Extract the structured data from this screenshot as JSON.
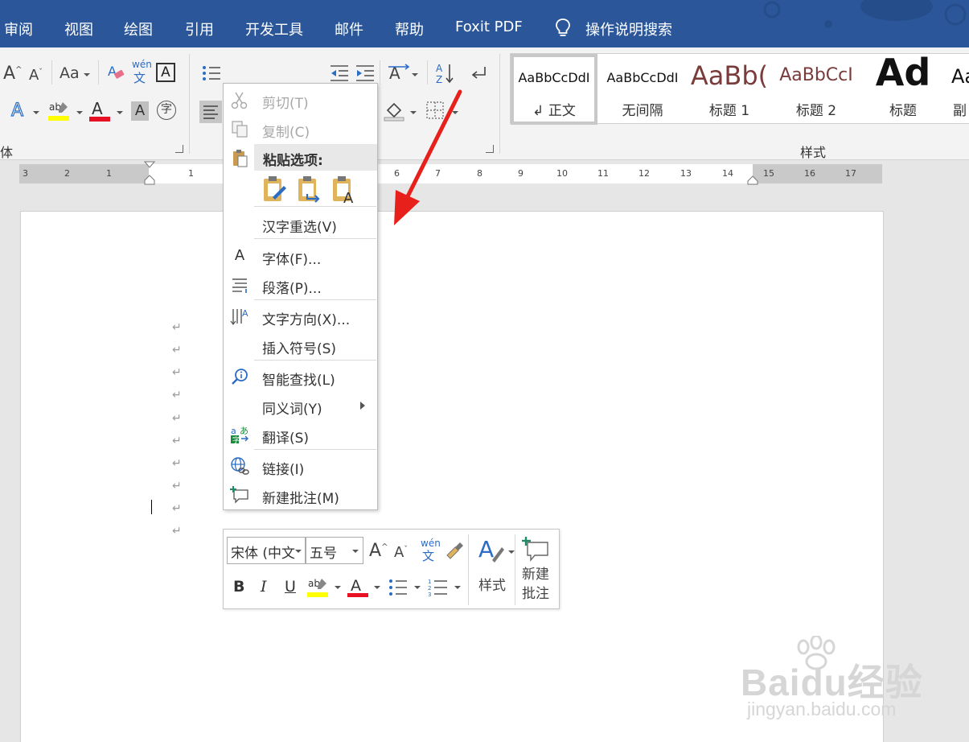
{
  "menubar": {
    "tabs": [
      "审阅",
      "视图",
      "绘图",
      "引用",
      "开发工具",
      "邮件",
      "帮助",
      "Foxit PDF"
    ],
    "search_label": "操作说明搜索"
  },
  "ribbon": {
    "font_group_label": "体",
    "change_case_label": "Aa",
    "phonetic_top": "wén",
    "phonetic_bottom": "文",
    "enclose_char": "字",
    "styles_group_label": "样式",
    "styles": [
      {
        "sample": "AaBbCcDdI",
        "name": "↲ 正文"
      },
      {
        "sample": "AaBbCcDdI",
        "name": "无间隔"
      },
      {
        "sample": "AaBb(",
        "name": "标题 1"
      },
      {
        "sample": "AaBbCcI",
        "name": "标题 2"
      },
      {
        "sample": "Ad",
        "name": "标题"
      },
      {
        "sample": "Aa",
        "name": "副"
      }
    ]
  },
  "ruler": {
    "numbers": [
      "3",
      "2",
      "1",
      "1",
      "6",
      "7",
      "8",
      "9",
      "10",
      "11",
      "12",
      "13",
      "14",
      "15",
      "16",
      "17"
    ]
  },
  "document": {
    "paragraph_mark": "↵"
  },
  "context_menu": {
    "cut": "剪切(T)",
    "copy": "复制(C)",
    "paste_options": "粘贴选项:",
    "reconvert": "汉字重选(V)",
    "font": "字体(F)...",
    "paragraph": "段落(P)...",
    "text_direction": "文字方向(X)...",
    "insert_symbol": "插入符号(S)",
    "smart_lookup": "智能查找(L)",
    "synonyms": "同义词(Y)",
    "translate": "翻译(S)",
    "link": "链接(I)",
    "new_comment": "新建批注(M)"
  },
  "mini_toolbar": {
    "font_name": "宋体 (中文",
    "font_size": "五号",
    "phonetic_top": "wén",
    "phonetic_bottom": "文",
    "styles_label": "样式",
    "new_comment_line1": "新建",
    "new_comment_line2": "批注",
    "bold": "B",
    "italic": "I",
    "underline": "U"
  },
  "watermark": {
    "logo": "Baidu经验",
    "url": "jingyan.baidu.com"
  },
  "colors": {
    "title_bar": "#2b579a",
    "ribbon_bg": "#f3f3f3",
    "highlight": "#ffff00",
    "font_color": "#e81123",
    "accent_blue": "#2b6cc4",
    "annotation_arrow": "#e8201b"
  }
}
